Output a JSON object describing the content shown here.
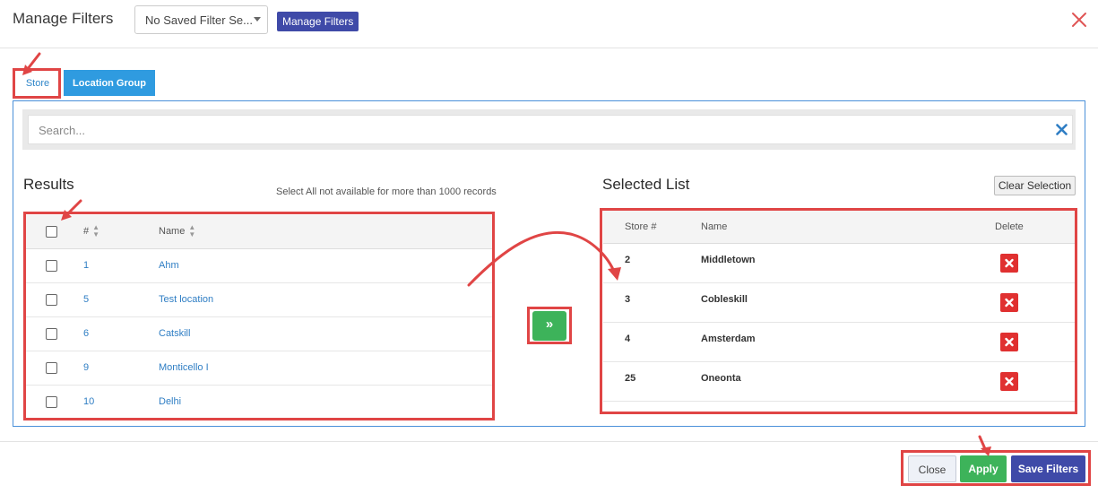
{
  "header": {
    "title": "Manage Filters",
    "saved_filter_value": "No Saved Filter Se...",
    "manage_button": "Manage Filters"
  },
  "tabs": [
    {
      "label": "Store"
    },
    {
      "label": "Location Group"
    }
  ],
  "search": {
    "placeholder": "Search..."
  },
  "results": {
    "title": "Results",
    "note": "Select All not available for more than 1000 records",
    "columns": {
      "number": "#",
      "name": "Name"
    },
    "rows": [
      {
        "number": "1",
        "name": "Ahm"
      },
      {
        "number": "5",
        "name": "Test location"
      },
      {
        "number": "6",
        "name": "Catskill"
      },
      {
        "number": "9",
        "name": "Monticello I"
      },
      {
        "number": "10",
        "name": "Delhi"
      }
    ]
  },
  "selected": {
    "title": "Selected List",
    "clear_label": "Clear Selection",
    "columns": {
      "number": "Store #",
      "name": "Name",
      "delete": "Delete"
    },
    "rows": [
      {
        "number": "2",
        "name": "Middletown"
      },
      {
        "number": "3",
        "name": "Cobleskill"
      },
      {
        "number": "4",
        "name": "Amsterdam"
      },
      {
        "number": "25",
        "name": "Oneonta"
      }
    ]
  },
  "move_button": {
    "label": "»"
  },
  "footer": {
    "close": "Close",
    "apply": "Apply",
    "save": "Save Filters"
  },
  "colors": {
    "primary": "#3f4aa8",
    "success": "#3db35a",
    "danger": "#e03030",
    "tab_active": "#2f9be0",
    "annotation": "#e04545"
  }
}
